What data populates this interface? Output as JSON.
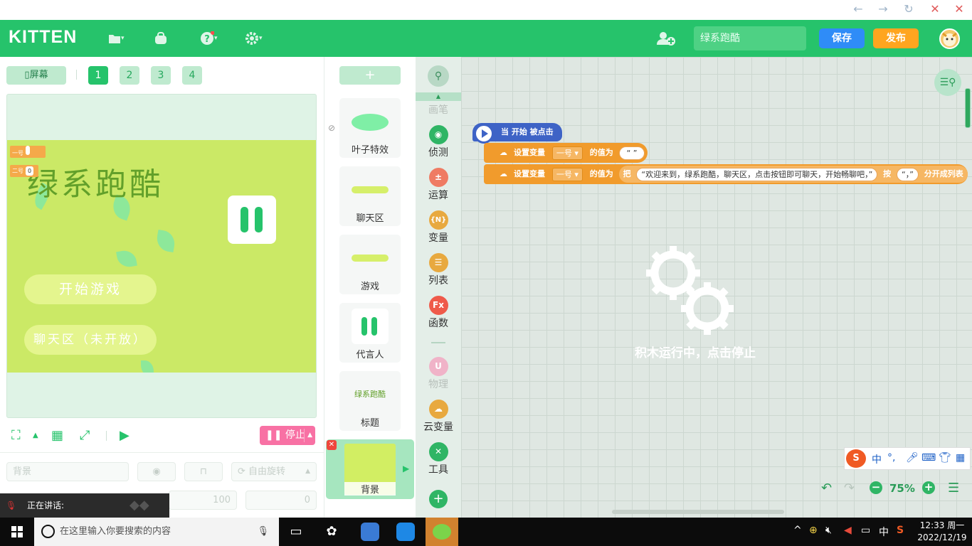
{
  "window": {
    "back": "←",
    "forward": "→",
    "refresh": "↻",
    "close": "✕"
  },
  "header": {
    "logo": "KITTEN",
    "project_name": "绿系跑酷",
    "save_label": "保存",
    "publish_label": "发布",
    "colors": {
      "brand": "#26c36b",
      "save": "#2f8cf7",
      "publish": "#ffa51f"
    }
  },
  "stage_toolbar": {
    "screen_label": "屏幕",
    "pages": [
      "1",
      "2",
      "3",
      "4"
    ],
    "active_page": "1"
  },
  "stage": {
    "title": "绿系跑酷",
    "buttons": {
      "start": "开始游戏",
      "chat": "聊天区（未开放）"
    },
    "variables": [
      {
        "name": "一号",
        "value": ""
      },
      {
        "name": "二号",
        "value": "0"
      }
    ]
  },
  "stage_controls": {
    "stop_label": "停止"
  },
  "props": {
    "name_placeholder": "背景",
    "rotation_label": "自由旋转",
    "size_value": "100",
    "direction_value": "0"
  },
  "sprites": {
    "add_label": "+",
    "items": [
      {
        "name": "叶子特效"
      },
      {
        "name": "聊天区"
      },
      {
        "name": "游戏"
      },
      {
        "name": "代言人"
      },
      {
        "name": "标题",
        "thumb_text": "绿系跑酷"
      },
      {
        "name": "背景"
      }
    ]
  },
  "categories": [
    {
      "label": "画笔",
      "icon": "pen-icon"
    },
    {
      "label": "侦测",
      "icon": "sensing-icon",
      "color": "#2fb565"
    },
    {
      "label": "运算",
      "icon": "operator-icon",
      "color": "#ef7b63"
    },
    {
      "label": "变量",
      "icon": "variable-icon",
      "glyph": "{N}",
      "color": "#e8a93f"
    },
    {
      "label": "列表",
      "icon": "list-icon",
      "color": "#e8a93f"
    },
    {
      "label": "函数",
      "icon": "function-icon",
      "glyph": "Fx",
      "color": "#ef5a4a"
    },
    {
      "label": "物理",
      "icon": "physics-icon",
      "color": "#f0b3c8"
    },
    {
      "label": "云变量",
      "icon": "cloud-variable-icon",
      "color": "#e8a93f"
    },
    {
      "label": "工具",
      "icon": "tools-icon",
      "color": "#2fb565"
    }
  ],
  "blocks": {
    "hat": "当 开始 被点击",
    "row1": {
      "action": "设置变量",
      "var": "一号",
      "mid": "的值为",
      "value": "“ ”"
    },
    "row2": {
      "action": "设置变量",
      "var": "一号",
      "mid": "的值为",
      "prefix": "把",
      "text": "“欢迎来到，绿系跑酷，聊天区，点击按钮即可聊天，开始畅聊吧，”",
      "by": "按",
      "sep": "“，”",
      "suffix": "分开成列表"
    }
  },
  "workspace": {
    "running_text": "积木运行中，点击停止",
    "zoom": "75%"
  },
  "ime": {
    "lang": "中"
  },
  "voice": {
    "label": "正在讲话:"
  },
  "taskbar": {
    "search_placeholder": "在这里输入你要搜索的内容",
    "time": "12:33 周一",
    "date": "2022/12/19",
    "tray_lang": "中"
  }
}
